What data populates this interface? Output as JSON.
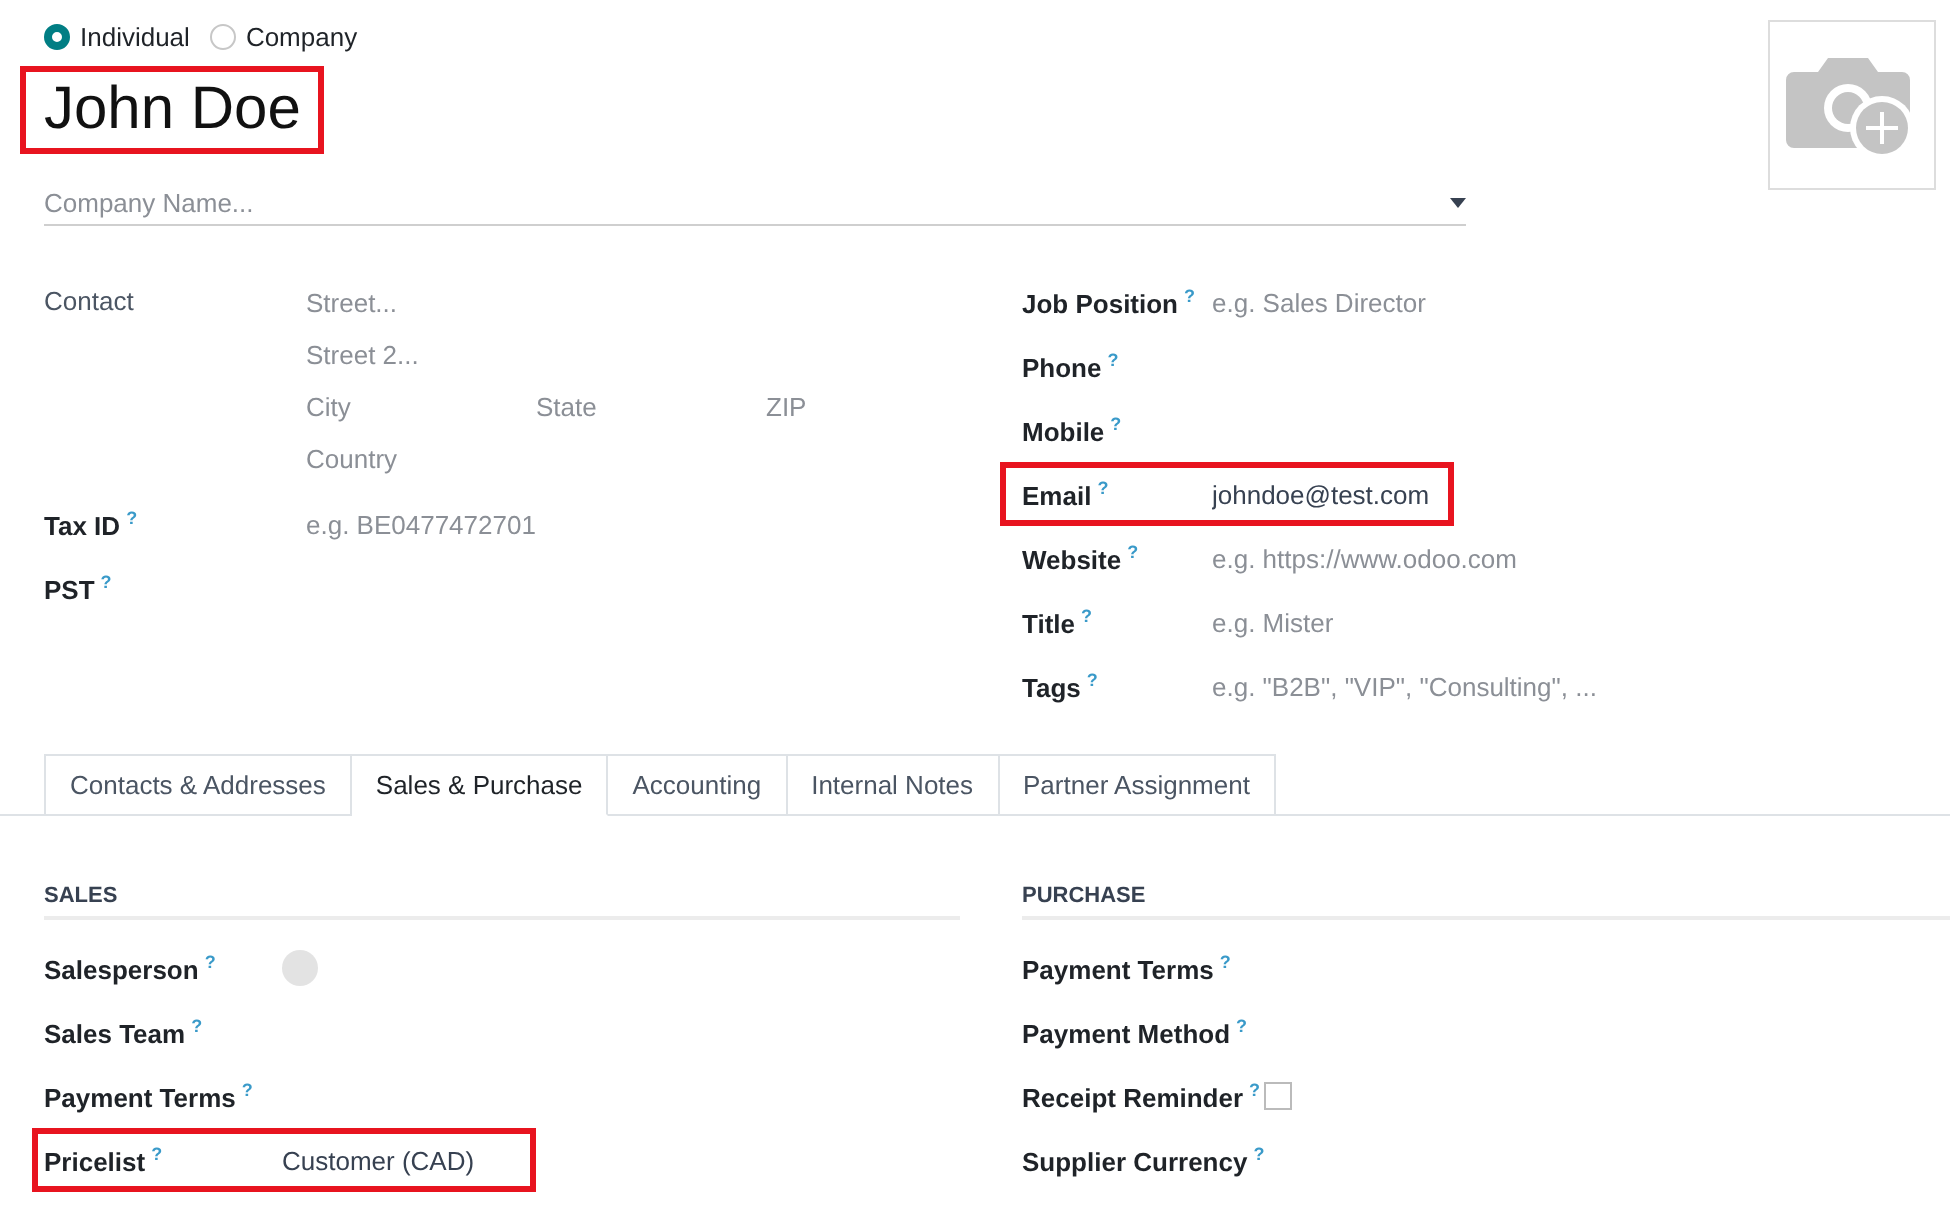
{
  "partner_type": [
    {
      "label": "Individual",
      "selected": true
    },
    {
      "label": "Company",
      "selected": false
    }
  ],
  "name": {
    "value": "John Doe",
    "highlighted": true
  },
  "company_field": {
    "placeholder": "Company Name..."
  },
  "address": {
    "label": "Contact",
    "lines": [
      [
        {
          "placeholder": "Street..."
        }
      ],
      [
        {
          "placeholder": "Street 2..."
        }
      ],
      [
        {
          "placeholder": "City"
        },
        {
          "placeholder": "State"
        },
        {
          "placeholder": "ZIP"
        }
      ],
      [
        {
          "placeholder": "Country"
        }
      ]
    ]
  },
  "left_fields": [
    {
      "label": "Tax ID",
      "help": "?",
      "placeholder": "e.g. BE0477472701",
      "highlighted": false
    },
    {
      "label": "PST",
      "help": "?",
      "highlighted": false
    }
  ],
  "right_fields": [
    {
      "label": "Job Position",
      "help": "?",
      "placeholder": "e.g. Sales Director",
      "highlighted": false
    },
    {
      "label": "Phone",
      "help": "?",
      "highlighted": false
    },
    {
      "label": "Mobile",
      "help": "?",
      "highlighted": false
    },
    {
      "label": "Email",
      "help": "?",
      "value": "johndoe@test.com",
      "highlighted": true
    },
    {
      "label": "Website",
      "help": "?",
      "placeholder": "e.g. https://www.odoo.com",
      "highlighted": false
    },
    {
      "label": "Title",
      "help": "?",
      "placeholder": "e.g. Mister",
      "highlighted": false
    },
    {
      "label": "Tags",
      "help": "?",
      "placeholder": "e.g. \"B2B\", \"VIP\", \"Consulting\", ...",
      "highlighted": false
    }
  ],
  "tabs": [
    {
      "label": "Contacts & Addresses",
      "selected": false
    },
    {
      "label": "Sales & Purchase",
      "selected": true
    },
    {
      "label": "Accounting",
      "selected": false
    },
    {
      "label": "Internal Notes",
      "selected": false
    },
    {
      "label": "Partner Assignment",
      "selected": false
    }
  ],
  "sections": [
    {
      "title": "SALES",
      "fields": [
        {
          "label": "Salesperson",
          "help": "?",
          "kind": "avatar",
          "highlighted": false
        },
        {
          "label": "Sales Team",
          "help": "?",
          "kind": "text",
          "highlighted": false
        },
        {
          "label": "Payment Terms",
          "help": "?",
          "kind": "text",
          "highlighted": false
        },
        {
          "label": "Pricelist",
          "help": "?",
          "kind": "text",
          "value": "Customer (CAD)",
          "highlighted": true
        }
      ]
    },
    {
      "title": "PURCHASE",
      "fields": [
        {
          "label": "Payment Terms",
          "help": "?",
          "kind": "text",
          "highlighted": false
        },
        {
          "label": "Payment Method",
          "help": "?",
          "kind": "text",
          "highlighted": false
        },
        {
          "label": "Receipt Reminder",
          "help": "?",
          "kind": "checkbox",
          "checked": false,
          "highlighted": false
        },
        {
          "label": "Supplier Currency",
          "help": "?",
          "kind": "text",
          "highlighted": false
        }
      ]
    }
  ]
}
